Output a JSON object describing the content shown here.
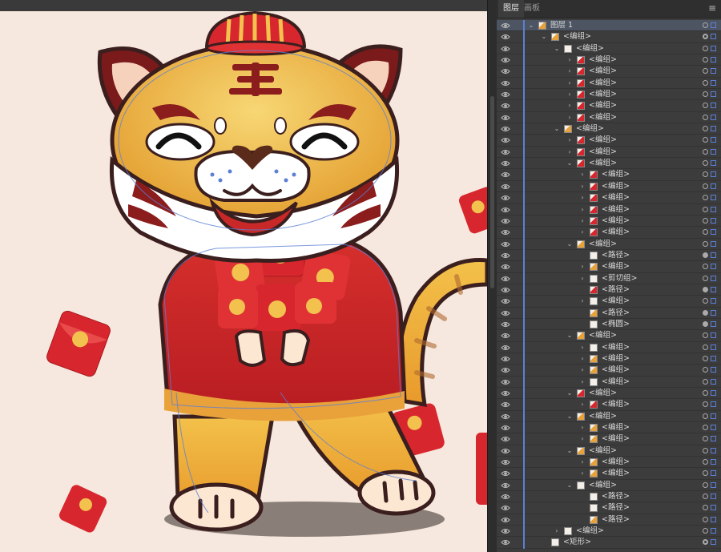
{
  "panel": {
    "tabs": [
      {
        "label": "图层",
        "active": true
      },
      {
        "label": "画板",
        "active": false
      }
    ],
    "menu_icon": "hamburger-menu-icon"
  },
  "layers": [
    {
      "label": "图层 1",
      "indent": 0,
      "caret": "down",
      "thumb": "tiger",
      "selected": true
    },
    {
      "label": "<编组>",
      "indent": 1,
      "caret": "down",
      "thumb": "tiger",
      "target": "ring"
    },
    {
      "label": "<编组>",
      "indent": 2,
      "caret": "down",
      "thumb": "dots"
    },
    {
      "label": "<编组>",
      "indent": 3,
      "caret": "right",
      "thumb": "red"
    },
    {
      "label": "<编组>",
      "indent": 3,
      "caret": "right",
      "thumb": "red"
    },
    {
      "label": "<编组>",
      "indent": 3,
      "caret": "right",
      "thumb": "red"
    },
    {
      "label": "<编组>",
      "indent": 3,
      "caret": "right",
      "thumb": "red"
    },
    {
      "label": "<编组>",
      "indent": 3,
      "caret": "right",
      "thumb": "red"
    },
    {
      "label": "<编组>",
      "indent": 3,
      "caret": "right",
      "thumb": "red"
    },
    {
      "label": "<编组>",
      "indent": 2,
      "caret": "down",
      "thumb": "tiger"
    },
    {
      "label": "<编组>",
      "indent": 3,
      "caret": "right",
      "thumb": "red"
    },
    {
      "label": "<编组>",
      "indent": 3,
      "caret": "right",
      "thumb": "red"
    },
    {
      "label": "<编组>",
      "indent": 3,
      "caret": "down",
      "thumb": "red"
    },
    {
      "label": "<编组>",
      "indent": 4,
      "caret": "right",
      "thumb": "red"
    },
    {
      "label": "<编组>",
      "indent": 4,
      "caret": "right",
      "thumb": "red"
    },
    {
      "label": "<编组>",
      "indent": 4,
      "caret": "right",
      "thumb": "red"
    },
    {
      "label": "<编组>",
      "indent": 4,
      "caret": "right",
      "thumb": "red"
    },
    {
      "label": "<编组>",
      "indent": 4,
      "caret": "right",
      "thumb": "red"
    },
    {
      "label": "<编组>",
      "indent": 4,
      "caret": "right",
      "thumb": "red"
    },
    {
      "label": "<编组>",
      "indent": 3,
      "caret": "down",
      "thumb": "face"
    },
    {
      "label": "<路径>",
      "indent": 4,
      "caret": "none",
      "thumb": "white",
      "target": "filled"
    },
    {
      "label": "<编组>",
      "indent": 4,
      "caret": "right",
      "thumb": "orange"
    },
    {
      "label": "<剪切组>",
      "indent": 4,
      "caret": "right",
      "thumb": "white"
    },
    {
      "label": "<路径>",
      "indent": 4,
      "caret": "none",
      "thumb": "red",
      "target": "filled"
    },
    {
      "label": "<编组>",
      "indent": 4,
      "caret": "right",
      "thumb": "white"
    },
    {
      "label": "<路径>",
      "indent": 4,
      "caret": "none",
      "thumb": "orange",
      "target": "filled"
    },
    {
      "label": "<椭圆>",
      "indent": 4,
      "caret": "none",
      "thumb": "white",
      "target": "filled"
    },
    {
      "label": "<编组>",
      "indent": 3,
      "caret": "down",
      "thumb": "tiger"
    },
    {
      "label": "<编组>",
      "indent": 4,
      "caret": "right",
      "thumb": "white"
    },
    {
      "label": "<编组>",
      "indent": 4,
      "caret": "right",
      "thumb": "tiger"
    },
    {
      "label": "<编组>",
      "indent": 4,
      "caret": "right",
      "thumb": "orange"
    },
    {
      "label": "<编组>",
      "indent": 4,
      "caret": "right",
      "thumb": "white"
    },
    {
      "label": "<编组>",
      "indent": 3,
      "caret": "down",
      "thumb": "red"
    },
    {
      "label": "<编组>",
      "indent": 4,
      "caret": "right",
      "thumb": "red"
    },
    {
      "label": "<编组>",
      "indent": 3,
      "caret": "down",
      "thumb": "orange"
    },
    {
      "label": "<编组>",
      "indent": 4,
      "caret": "right",
      "thumb": "orange"
    },
    {
      "label": "<编组>",
      "indent": 4,
      "caret": "right",
      "thumb": "orange"
    },
    {
      "label": "<编组>",
      "indent": 3,
      "caret": "down",
      "thumb": "orange"
    },
    {
      "label": "<编组>",
      "indent": 4,
      "caret": "right",
      "thumb": "orange"
    },
    {
      "label": "<编组>",
      "indent": 4,
      "caret": "right",
      "thumb": "orange"
    },
    {
      "label": "<编组>",
      "indent": 3,
      "caret": "down",
      "thumb": "stripe"
    },
    {
      "label": "<路径>",
      "indent": 4,
      "caret": "none",
      "thumb": "stripe"
    },
    {
      "label": "<路径>",
      "indent": 4,
      "caret": "none",
      "thumb": "stripe"
    },
    {
      "label": "<路径>",
      "indent": 4,
      "caret": "none",
      "thumb": "orange"
    },
    {
      "label": "<编组>",
      "indent": 2,
      "caret": "right",
      "thumb": "white"
    },
    {
      "label": "<矩形>",
      "indent": 1,
      "caret": "none",
      "thumb": "white",
      "target": "ring"
    }
  ],
  "colors": {
    "canvas_bg": "#f6e8de",
    "panel_bg": "#3c3c3c",
    "accent": "#5b7fd6",
    "envelope_red": "#d8262e",
    "coin": "#f2c14e",
    "tiger_orange": "#f0a830"
  }
}
